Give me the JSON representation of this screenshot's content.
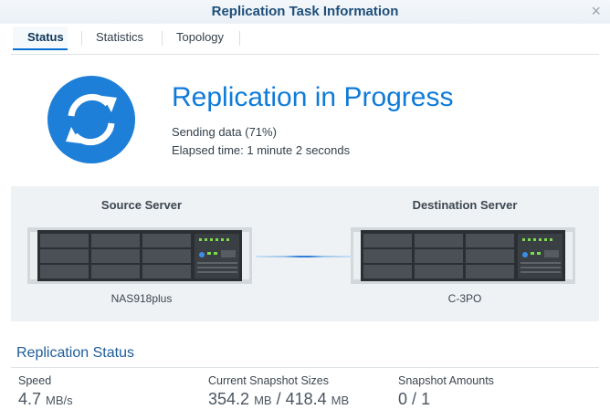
{
  "window": {
    "title": "Replication Task Information",
    "close_glyph": "×"
  },
  "tabs": [
    {
      "label": "Status",
      "active": true
    },
    {
      "label": "Statistics",
      "active": false
    },
    {
      "label": "Topology",
      "active": false
    }
  ],
  "status": {
    "headline": "Replication in Progress",
    "sending": "Sending data (71%)",
    "progress_fraction": 0.71,
    "elapsed": "Elapsed time: 1 minute 2 seconds",
    "icon": "sync-icon",
    "accent": "#1e7fd8"
  },
  "servers": {
    "source": {
      "label": "Source Server",
      "name": "NAS918plus",
      "icon": "rack-server-icon"
    },
    "destination": {
      "label": "Destination Server",
      "name": "C-3PO",
      "icon": "rack-server-icon"
    }
  },
  "replication_status": {
    "title": "Replication Status",
    "speed": {
      "label": "Speed",
      "value": "4.7",
      "unit": "MB/s"
    },
    "snapshot_sizes": {
      "label": "Current Snapshot Sizes",
      "value1": "354.2",
      "unit1": "MB",
      "sep": "/",
      "value2": "418.4",
      "unit2": "MB"
    },
    "snapshot_amounts": {
      "label": "Snapshot Amounts",
      "value1": "0",
      "sep": "/",
      "value2": "1"
    }
  }
}
